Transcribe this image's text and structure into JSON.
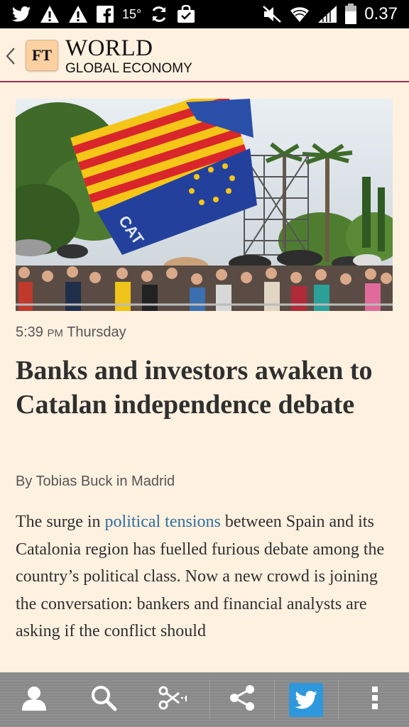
{
  "status_bar": {
    "temperature": "15°",
    "time": "0.37",
    "left_icons": [
      "twitter-icon",
      "warning-icon",
      "warning-icon",
      "facebook-icon",
      "weather-temp",
      "sync-icon",
      "shopping-bag-icon"
    ],
    "right_icons": [
      "mute-icon",
      "wifi-icon",
      "signal-icon",
      "battery-icon"
    ]
  },
  "header": {
    "logo": "FT",
    "title": "WORLD",
    "subtitle": "GLOBAL ECONOMY"
  },
  "article": {
    "photo_icon": "protest-crowd-flags-image",
    "time": "5:39",
    "ampm": "PM",
    "day": "Thursday",
    "headline": "Banks and investors awaken to Catalan independence debate",
    "byline": "By Tobias Buck in Madrid",
    "body_before_link": "The surge in ",
    "body_link": "political tensions",
    "body_after_link": " between Spain and its Catalonia region has fuelled furious debate among the country’s political class. Now a new crowd is joining the conversation: bankers and financial analysts are asking if the conflict should"
  },
  "bottom_bar": {
    "items": [
      "profile-icon",
      "search-icon",
      "clip-icon",
      "share-icon",
      "twitter-icon",
      "overflow-menu-icon"
    ]
  },
  "colors": {
    "background": "#fff1e0",
    "accent_rule": "#9e2f50",
    "link": "#2e6e9e",
    "twitter": "#2f97db",
    "toolbar": "#8c8c8c"
  }
}
